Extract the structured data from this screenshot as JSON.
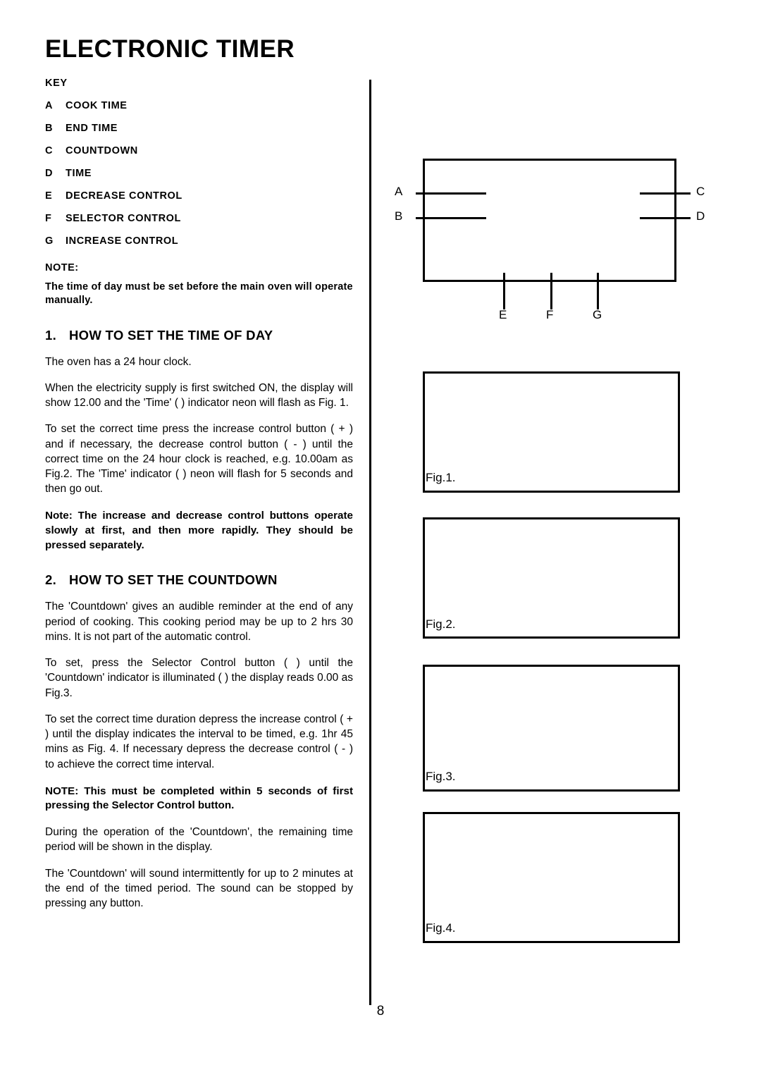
{
  "document": {
    "title": "ELECTRONIC TIMER",
    "page_number": "8"
  },
  "key": {
    "heading": "KEY",
    "items": [
      {
        "letter": "A",
        "label": "COOK TIME"
      },
      {
        "letter": "B",
        "label": "END TIME"
      },
      {
        "letter": "C",
        "label": "COUNTDOWN"
      },
      {
        "letter": "D",
        "label": "TIME"
      },
      {
        "letter": "E",
        "label": "DECREASE CONTROL"
      },
      {
        "letter": "F",
        "label": "SELECTOR CONTROL"
      },
      {
        "letter": "G",
        "label": "INCREASE CONTROL"
      }
    ]
  },
  "note": {
    "heading": "NOTE:",
    "text": "The time of day must be set before the main oven will operate manually."
  },
  "sections": [
    {
      "number": "1.",
      "heading": "HOW TO SET THE TIME OF DAY",
      "paragraphs": [
        "The oven has a 24 hour clock.",
        "When the electricity supply is first switched ON, the display will show 12.00 and the 'Time' (    ) indicator neon will flash as Fig. 1.",
        "To set the correct time press the increase control button ( + ) and if necessary, the decrease control button ( - ) until the correct time on the 24 hour clock is reached, e.g. 10.00am as Fig.2.  The 'Time' indicator (    ) neon will flash for 5 seconds and then go out."
      ],
      "bold_note": "Note: The increase and decrease control buttons operate slowly at first, and then more rapidly. They should be pressed separately."
    },
    {
      "number": "2.",
      "heading": "HOW TO SET THE COUNTDOWN",
      "paragraphs": [
        "The 'Countdown' gives an audible reminder at the end of any period of cooking.  This cooking period may be up to 2 hrs 30 mins.  It is not part of the automatic control.",
        "To set, press the Selector Control button (      ) until the 'Countdown' indicator is illuminated (      ) the display reads 0.00 as Fig.3.",
        "To set the correct time duration depress the increase control ( + ) until the display indicates the interval to be timed, e.g. 1hr 45 mins as Fig. 4.  If necessary depress the decrease control ( - ) to achieve the correct time interval."
      ],
      "bold_note": "NOTE:  This must be completed within 5 seconds of first pressing the Selector Control button.",
      "trailing_paragraphs": [
        "During the operation of the 'Countdown', the remaining time period will be shown in the display.",
        "The 'Countdown' will sound intermittently for up to 2 minutes at the end of the timed period.  The sound can be stopped by pressing any button."
      ]
    }
  ],
  "diagram": {
    "callouts": [
      {
        "id": "A",
        "label": "A"
      },
      {
        "id": "B",
        "label": "B"
      },
      {
        "id": "C",
        "label": "C"
      },
      {
        "id": "D",
        "label": "D"
      },
      {
        "id": "E",
        "label": "E"
      },
      {
        "id": "F",
        "label": "F"
      },
      {
        "id": "G",
        "label": "G"
      }
    ]
  },
  "figures": [
    {
      "label": "Fig.1."
    },
    {
      "label": "Fig.2."
    },
    {
      "label": "Fig.3."
    },
    {
      "label": "Fig.4."
    }
  ]
}
